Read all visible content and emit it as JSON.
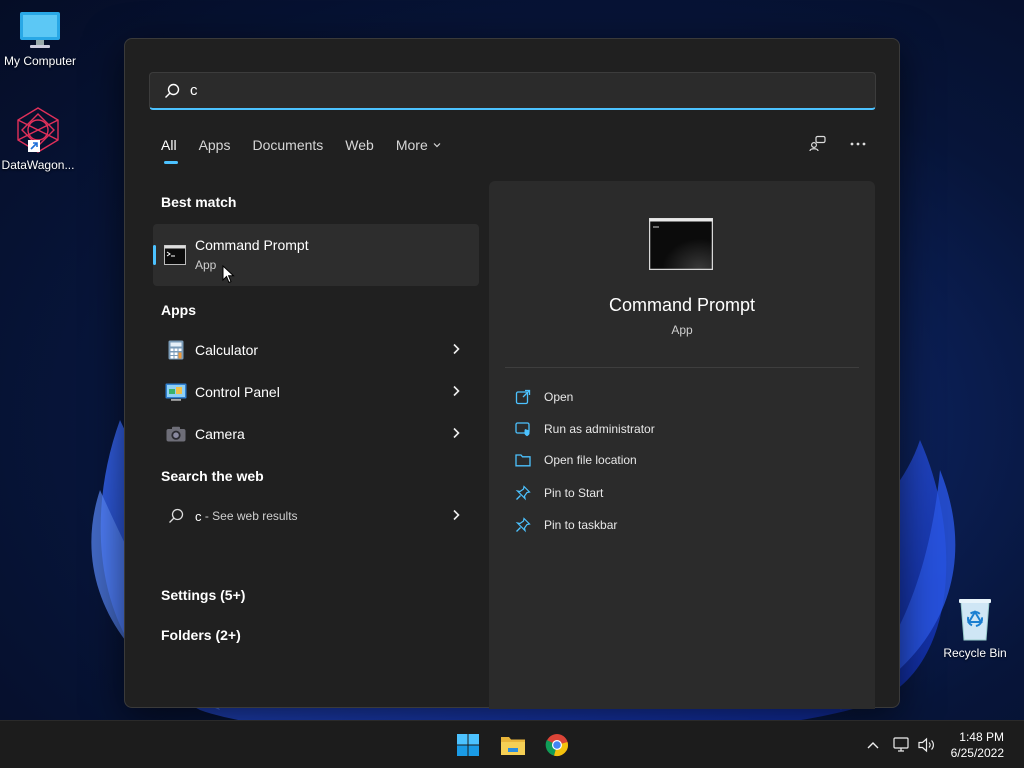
{
  "desktop": {
    "icons": [
      {
        "label": "My Computer",
        "icon": "monitor-icon"
      },
      {
        "label": "DataWagon...",
        "icon": "datawagon-app-icon"
      },
      {
        "label": "Recycle Bin",
        "icon": "recycle-bin-icon"
      }
    ]
  },
  "search": {
    "query": "c",
    "icon": "search-icon"
  },
  "tabs": [
    {
      "label": "All",
      "active": true
    },
    {
      "label": "Apps"
    },
    {
      "label": "Documents"
    },
    {
      "label": "Web"
    },
    {
      "label": "More"
    }
  ],
  "top_actions": {
    "share": "share-feedback-icon",
    "more": "ellipsis-icon"
  },
  "results": {
    "best_match_header": "Best match",
    "best_match": {
      "title": "Command Prompt",
      "subtitle": "App",
      "icon": "command-prompt-icon"
    },
    "apps_header": "Apps",
    "apps": [
      {
        "label": "Calculator",
        "icon": "calculator-icon"
      },
      {
        "label": "Control Panel",
        "icon": "control-panel-icon"
      },
      {
        "label": "Camera",
        "icon": "camera-icon"
      }
    ],
    "web_header": "Search the web",
    "web_query": "c",
    "web_suffix": " - See web results",
    "settings_header": "Settings (5+)",
    "folders_header": "Folders (2+)"
  },
  "preview": {
    "title": "Command Prompt",
    "subtitle": "App",
    "actions": [
      {
        "label": "Open",
        "icon": "open-external-icon"
      },
      {
        "label": "Run as administrator",
        "icon": "run-as-admin-icon"
      },
      {
        "label": "Open file location",
        "icon": "folder-icon"
      },
      {
        "label": "Pin to Start",
        "icon": "pin-icon"
      },
      {
        "label": "Pin to taskbar",
        "icon": "pin-icon"
      }
    ]
  },
  "taskbar": {
    "apps": [
      {
        "name": "Start",
        "icon": "windows-start-icon"
      },
      {
        "name": "File Explorer",
        "icon": "file-explorer-icon"
      },
      {
        "name": "Chrome",
        "icon": "chrome-icon"
      }
    ],
    "time": "1:48 PM",
    "date": "6/25/2022"
  },
  "colors": {
    "accent": "#4cc2ff",
    "panel": "#202020",
    "pane": "#2b2b2b"
  }
}
